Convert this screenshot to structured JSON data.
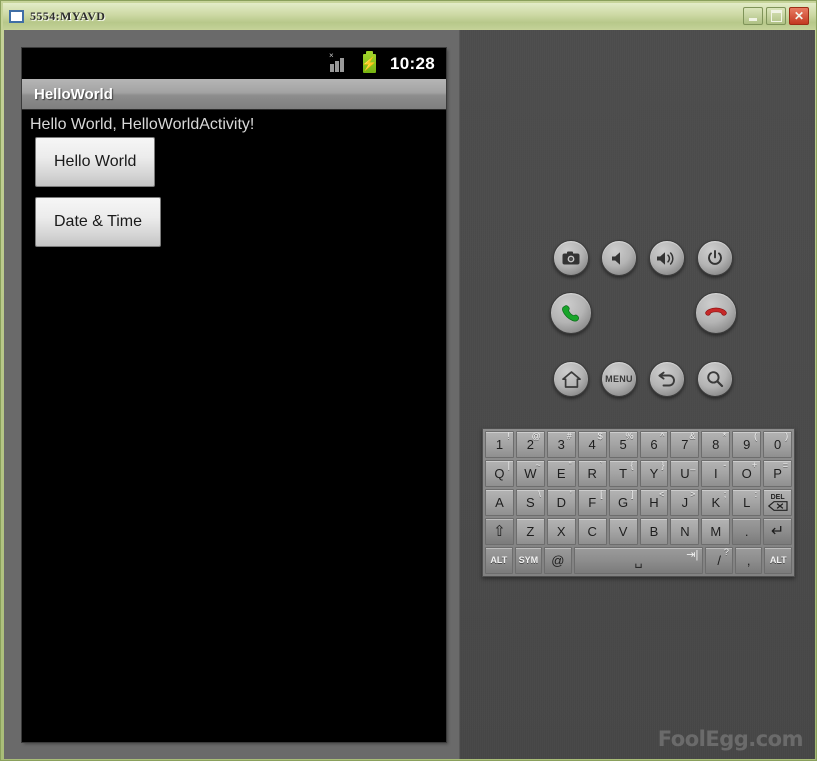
{
  "window": {
    "title": "5554:MYAVD",
    "icon": "window-icon",
    "buttons": [
      {
        "name": "minimize",
        "label": "_"
      },
      {
        "name": "maximize",
        "label": "□"
      },
      {
        "name": "close",
        "label": "✕"
      }
    ]
  },
  "device": {
    "status_bar": {
      "signal_icon": "signal-bars-no-sim",
      "battery_icon": "battery-charging",
      "time": "10:28"
    },
    "app": {
      "title": "HelloWorld",
      "text": "Hello World, HelloWorldActivity!",
      "buttons": [
        {
          "name": "hello-world-button",
          "label": "Hello World"
        },
        {
          "name": "date-time-button",
          "label": "Date & Time"
        }
      ]
    }
  },
  "controls": {
    "row1": [
      {
        "name": "camera-button",
        "icon": "camera-icon"
      },
      {
        "name": "volume-down-button",
        "icon": "volume-down-icon"
      },
      {
        "name": "volume-up-button",
        "icon": "volume-up-icon"
      },
      {
        "name": "power-button",
        "icon": "power-icon"
      }
    ],
    "row2": [
      {
        "name": "call-button",
        "icon": "phone-green-icon"
      },
      {
        "name": "dpad",
        "icon": "dpad-icon"
      },
      {
        "name": "end-call-button",
        "icon": "phone-red-icon"
      }
    ],
    "row3": [
      {
        "name": "home-button",
        "icon": "home-icon"
      },
      {
        "name": "menu-button",
        "icon": "menu-icon",
        "label": "MENU"
      },
      {
        "name": "back-button",
        "icon": "back-arrow-icon"
      },
      {
        "name": "search-button",
        "icon": "search-icon"
      }
    ]
  },
  "keyboard": {
    "rows": [
      [
        {
          "main": "1",
          "sup": "!"
        },
        {
          "main": "2",
          "sup": "@"
        },
        {
          "main": "3",
          "sup": "#"
        },
        {
          "main": "4",
          "sup": "$"
        },
        {
          "main": "5",
          "sup": "%"
        },
        {
          "main": "6",
          "sup": "^"
        },
        {
          "main": "7",
          "sup": "&"
        },
        {
          "main": "8",
          "sup": "*"
        },
        {
          "main": "9",
          "sup": "("
        },
        {
          "main": "0",
          "sup": ")"
        }
      ],
      [
        {
          "main": "Q",
          "sup": "|"
        },
        {
          "main": "W",
          "sup": "~"
        },
        {
          "main": "E",
          "sup": "\""
        },
        {
          "main": "R",
          "sup": "`"
        },
        {
          "main": "T",
          "sup": "{"
        },
        {
          "main": "Y",
          "sup": "}"
        },
        {
          "main": "U",
          "sup": "_"
        },
        {
          "main": "I",
          "sup": "-"
        },
        {
          "main": "O",
          "sup": "+"
        },
        {
          "main": "P",
          "sup": "="
        }
      ],
      [
        {
          "main": "A",
          "sup": ""
        },
        {
          "main": "S",
          "sup": "\\"
        },
        {
          "main": "D",
          "sup": "'"
        },
        {
          "main": "F",
          "sup": "["
        },
        {
          "main": "G",
          "sup": "]"
        },
        {
          "main": "H",
          "sup": "<"
        },
        {
          "main": "J",
          "sup": ">"
        },
        {
          "main": "K",
          "sup": ";"
        },
        {
          "main": "L",
          "sup": ":"
        },
        {
          "main": "DEL",
          "sup": ""
        }
      ],
      [
        {
          "main": "⇧",
          "sup": ""
        },
        {
          "main": "Z",
          "sup": ""
        },
        {
          "main": "X",
          "sup": ""
        },
        {
          "main": "C",
          "sup": ""
        },
        {
          "main": "V",
          "sup": ""
        },
        {
          "main": "B",
          "sup": ""
        },
        {
          "main": "N",
          "sup": ""
        },
        {
          "main": "M",
          "sup": ""
        },
        {
          "main": ".",
          "sup": ""
        },
        {
          "main": "↵",
          "sup": ""
        }
      ],
      [
        {
          "main": "ALT",
          "sup": ""
        },
        {
          "main": "SYM",
          "sup": ""
        },
        {
          "main": "@",
          "sup": ""
        },
        {
          "main": "␣",
          "sup": ""
        },
        {
          "main": "/",
          "sup": "?"
        },
        {
          "main": ",",
          "sup": ""
        },
        {
          "main": "ALT",
          "sup": ""
        }
      ]
    ]
  },
  "watermark": "FoolEgg.com",
  "colors": {
    "window_border": "#a9bd78",
    "panel_bg": "#4d4d4d",
    "screen_bg": "#000000",
    "battery_green": "#9fd32a",
    "call_green": "#1a8a2a",
    "endcall_red": "#b71c1c"
  }
}
